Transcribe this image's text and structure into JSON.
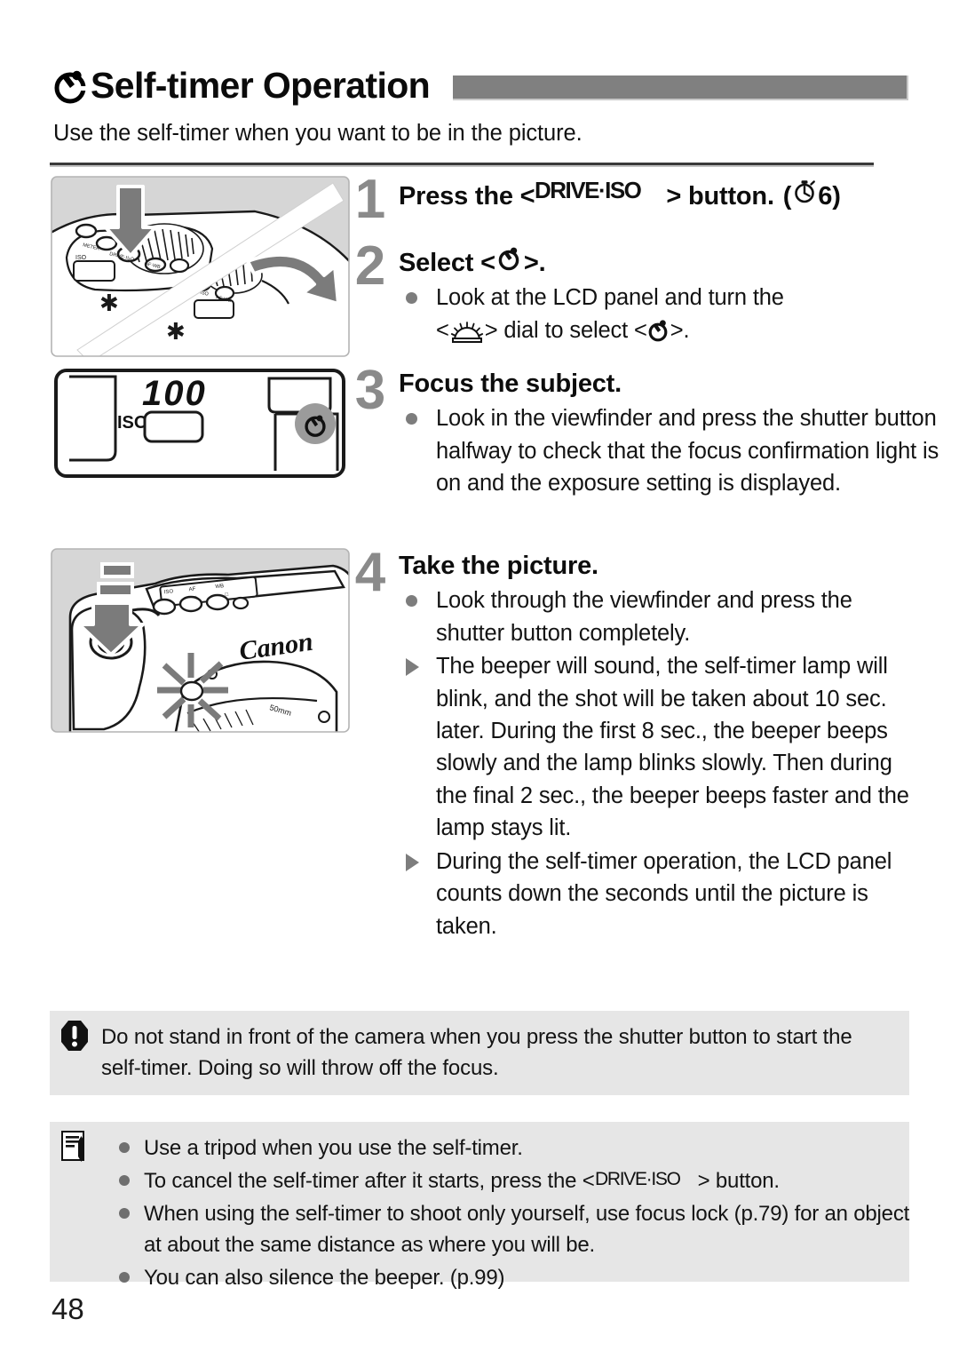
{
  "header": {
    "icon": "self-timer-icon",
    "title": "Self-timer Operation",
    "bar_color": "#808080"
  },
  "intro": "Use the self-timer when you want to be in the picture.",
  "steps": [
    {
      "number": "1",
      "heading_before": "Press the <",
      "heading_icon": "drive-iso-button-icon",
      "heading_icon_label": "DRIVE·ISO",
      "heading_after": "> button.",
      "heading_tail_open": "(",
      "heading_tail_icon": "stopwatch-icon",
      "heading_tail_value": "6",
      "heading_tail_close": ")",
      "bullets": []
    },
    {
      "number": "2",
      "heading_before": "Select <",
      "heading_icon": "self-timer-icon",
      "heading_after": ">.",
      "bullets": [
        {
          "marker": "dot",
          "parts": [
            {
              "type": "text",
              "value": "Look at the LCD panel and turn the"
            },
            {
              "type": "break"
            },
            {
              "type": "text",
              "value": "<"
            },
            {
              "type": "icon",
              "value": "main-dial-icon"
            },
            {
              "type": "text",
              "value": "> dial to select <"
            },
            {
              "type": "icon",
              "value": "self-timer-icon"
            },
            {
              "type": "text",
              "value": ">."
            }
          ]
        }
      ]
    },
    {
      "number": "3",
      "heading": "Focus the subject.",
      "bullets": [
        {
          "marker": "dot",
          "text": "Look in the viewfinder and press the shutter button halfway to check that the focus confirmation light is on and the exposure setting is displayed."
        }
      ]
    },
    {
      "number": "4",
      "heading": "Take the picture.",
      "bullets": [
        {
          "marker": "dot",
          "text": "Look through the viewfinder and press the shutter button completely."
        },
        {
          "marker": "triangle",
          "text": "The beeper will sound, the self-timer lamp will blink, and the shot will be taken about 10 sec. later. During the first 8 sec., the beeper beeps slowly and the lamp blinks slowly. Then during the final 2 sec., the beeper beeps faster and the lamp stays lit."
        },
        {
          "marker": "triangle",
          "text": "During the self-timer operation, the LCD panel counts down the seconds until the picture is taken."
        }
      ]
    }
  ],
  "figures": {
    "top": {
      "name": "camera-top-dial-illustration",
      "caption_hidden": "Camera top plate with DRIVE·ISO button pressed and main dial turning"
    },
    "lcd": {
      "name": "lcd-panel-illustration",
      "iso_label": "ISO",
      "iso_value": "100",
      "highlight_icon": "self-timer-icon"
    },
    "bottom": {
      "name": "camera-shutter-lamp-illustration",
      "brand": "Canon",
      "caption_hidden": "Pressing the shutter button while the self-timer lamp blinks"
    }
  },
  "warning": {
    "icon": "warning-icon",
    "text": "Do not stand in front of the camera when you press the shutter button to start the self-timer. Doing so will throw off the focus."
  },
  "notes": {
    "icon": "note-pencil-icon",
    "items": [
      {
        "type": "plain",
        "text": "Use a tripod when you use the self-timer."
      },
      {
        "type": "rich",
        "before": "To cancel the self-timer after it starts, press the <",
        "icon": "drive-iso-button-icon",
        "icon_label": "DRIVE·ISO",
        "after": "> button."
      },
      {
        "type": "plain",
        "text": "When using the self-timer to shoot only yourself, use focus lock (p.79) for an object at about the same distance as where you will be."
      },
      {
        "type": "plain",
        "text": "You can also silence the beeper. (p.99)"
      }
    ]
  },
  "page_number": "48",
  "colors": {
    "step_number": "#8a8a8a",
    "box_background": "#e6e6e6",
    "bullet_marker": "#7d7d7d",
    "title_bar": "#808080"
  }
}
